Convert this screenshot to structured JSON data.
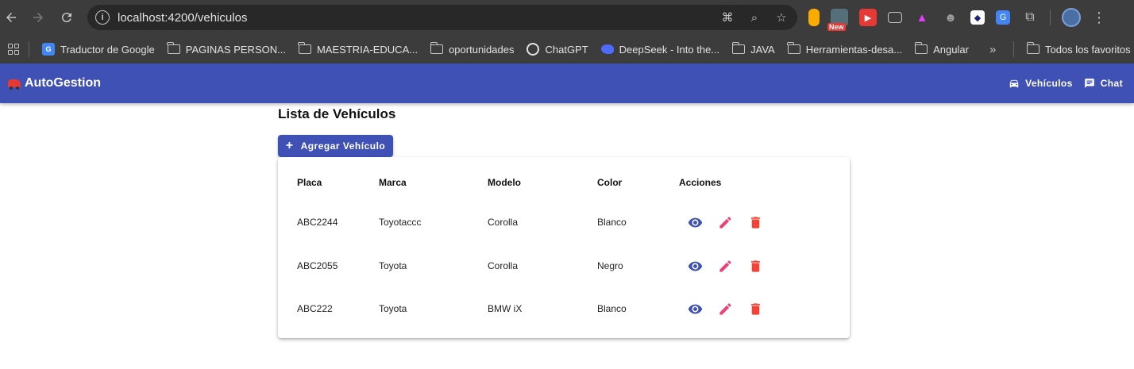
{
  "browser": {
    "url": "localhost:4200/vehiculos",
    "ext_new_badge": "New",
    "bookmarks": [
      {
        "label": "Traductor de Google",
        "icon": "google-translate-icon"
      },
      {
        "label": "PAGINAS PERSON...",
        "icon": "folder-icon"
      },
      {
        "label": "MAESTRIA-EDUCA...",
        "icon": "folder-icon"
      },
      {
        "label": "oportunidades",
        "icon": "folder-icon"
      },
      {
        "label": "ChatGPT",
        "icon": "chatgpt-icon"
      },
      {
        "label": "DeepSeek - Into the...",
        "icon": "deepseek-icon"
      },
      {
        "label": "JAVA",
        "icon": "folder-icon"
      },
      {
        "label": "Herramientas-desa...",
        "icon": "folder-icon"
      },
      {
        "label": "Angular",
        "icon": "folder-icon"
      }
    ],
    "all_bookmarks": "Todos los favoritos"
  },
  "app": {
    "brand": "AutoGestion",
    "nav": [
      {
        "label": "Vehículos",
        "icon": "car-icon"
      },
      {
        "label": "Chat",
        "icon": "chat-icon"
      }
    ],
    "accent_color": "#3f51b5"
  },
  "page": {
    "title": "Lista de Vehículos",
    "add_button": "Agregar Vehículo"
  },
  "table": {
    "headers": [
      "Placa",
      "Marca",
      "Modelo",
      "Color",
      "Acciones"
    ],
    "rows": [
      {
        "placa": "ABC2244",
        "marca": "Toyotaccc",
        "modelo": "Corolla",
        "color": "Blanco"
      },
      {
        "placa": "ABC2055",
        "marca": "Toyota",
        "modelo": "Corolla",
        "color": "Negro"
      },
      {
        "placa": "ABC222",
        "marca": "Toyota",
        "modelo": "BMW iX",
        "color": "Blanco"
      }
    ],
    "action_colors": {
      "view": "#3f51b5",
      "edit": "#ec407a",
      "delete": "#f44336"
    }
  }
}
